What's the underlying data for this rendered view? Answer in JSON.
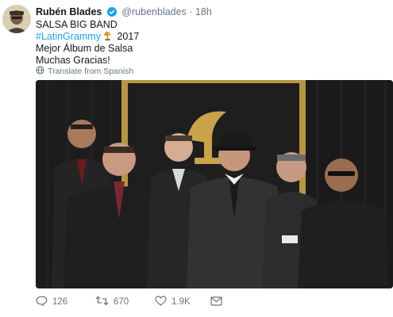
{
  "tweet": {
    "author_name": "Rubén Blades",
    "handle": "@rubenblades",
    "separator": "·",
    "time": "18h",
    "lines": {
      "l1": "SALSA BIG BAND",
      "hashtag": "#LatinGrammy",
      "year": "2017",
      "l3": "Mejor Álbum de Salsa",
      "l4": "Muchas Gracias!"
    },
    "translate_label": "Translate from Spanish",
    "icons": {
      "avatar": "avatar-image",
      "verified": "verified-badge-icon",
      "trophy": "grammy-trophy-emoji",
      "globe": "globe-icon",
      "reply": "reply-icon",
      "retweet": "retweet-icon",
      "like": "heart-icon",
      "dm": "envelope-icon"
    },
    "counts": {
      "replies": "126",
      "retweets": "670",
      "likes": "1.9K"
    },
    "colors": {
      "link": "#1da1f2",
      "muted": "#657786",
      "text": "#14171a"
    }
  }
}
